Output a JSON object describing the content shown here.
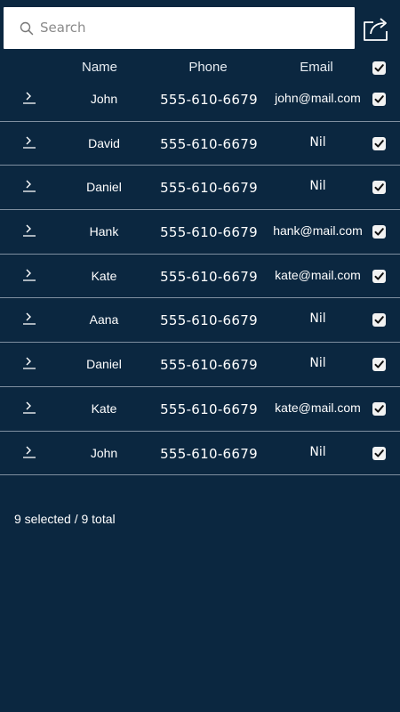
{
  "search": {
    "placeholder": "Search",
    "value": ""
  },
  "toolbar": {
    "share_icon": "share-icon"
  },
  "table": {
    "columns": [
      "Name",
      "Phone",
      "Email"
    ],
    "select_all_checked": true,
    "rows": [
      {
        "name": "John",
        "phone": "555-610-6679",
        "email": "john@mail.com",
        "checked": true
      },
      {
        "name": "David",
        "phone": "555-610-6679",
        "email": "Nil",
        "checked": true
      },
      {
        "name": "Daniel",
        "phone": "555-610-6679",
        "email": "Nil",
        "checked": true
      },
      {
        "name": "Hank",
        "phone": "555-610-6679",
        "email": "hank@mail.com",
        "checked": true
      },
      {
        "name": "Kate",
        "phone": "555-610-6679",
        "email": "kate@mail.com",
        "checked": true
      },
      {
        "name": "Aana",
        "phone": "555-610-6679",
        "email": "Nil",
        "checked": true
      },
      {
        "name": "Daniel",
        "phone": "555-610-6679",
        "email": "Nil",
        "checked": true
      },
      {
        "name": "Kate",
        "phone": "555-610-6679",
        "email": "kate@mail.com",
        "checked": true
      },
      {
        "name": "John",
        "phone": "555-610-6679",
        "email": "Nil",
        "checked": true
      }
    ]
  },
  "footer": {
    "status": "9 selected / 9 total"
  },
  "colors": {
    "background": "#0b2740",
    "divider": "#7f8fa0",
    "text": "#ffffff"
  }
}
